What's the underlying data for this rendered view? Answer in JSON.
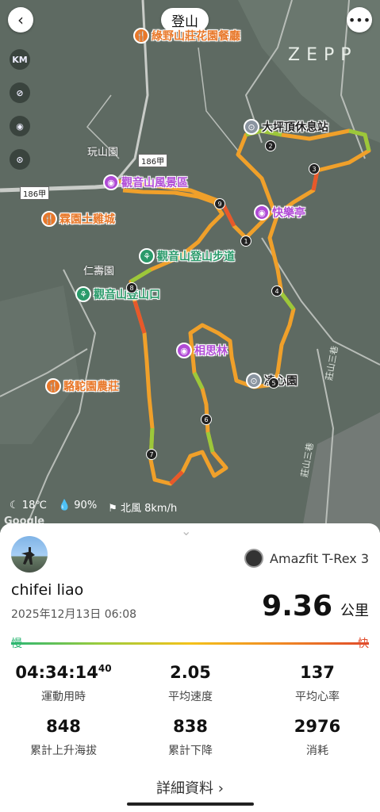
{
  "header": {
    "title": "登山",
    "back_icon": "chevron-left-icon",
    "more_icon": "more-horiz-icon",
    "brand": "ZEPP"
  },
  "toolbar": {
    "km_label": "KM"
  },
  "map": {
    "pois": [
      {
        "label": "綠野山莊花園餐廳",
        "color": "#e8782a",
        "glyph": "🍴"
      },
      {
        "label": "大坪頂休息站",
        "color": "#8a94a0",
        "glyph": "⊙"
      },
      {
        "label": "觀音山風景區",
        "color": "#b04ad6",
        "glyph": "◉"
      },
      {
        "label": "快樂亭",
        "color": "#b04ad6",
        "glyph": "◉"
      },
      {
        "label": "霖園土雞城",
        "color": "#e8782a",
        "glyph": "🍴"
      },
      {
        "label": "觀音山登山步道",
        "color": "#2a9a6a",
        "glyph": "⚘"
      },
      {
        "label": "觀音山登山口",
        "color": "#2a9a6a",
        "glyph": "⚘"
      },
      {
        "label": "相思林",
        "color": "#b04ad6",
        "glyph": "◉"
      },
      {
        "label": "凌心園",
        "color": "#8a94a0",
        "glyph": "⊙"
      },
      {
        "label": "駱駝園農莊",
        "color": "#e8782a",
        "glyph": "🍴"
      }
    ],
    "places": [
      "玩山園",
      "仁壽園"
    ],
    "road_badges": [
      "186甲",
      "186甲"
    ],
    "streets": [
      "莊山三巷",
      "莊山三巷"
    ],
    "waypoints": [
      "1",
      "2",
      "3",
      "4",
      "5",
      "6",
      "7",
      "8",
      "9"
    ],
    "weather": {
      "temp": "18℃",
      "humidity": "90%",
      "wind": "北風 8km/h"
    },
    "attribution": "Google"
  },
  "summary": {
    "device": "Amazfit T-Rex 3",
    "user": "chifei liao",
    "date": "2025年12月13日 06:08",
    "distance": "9.36",
    "distance_unit": "公里",
    "pace_slow": "慢",
    "pace_fast": "快",
    "stats": [
      {
        "value": "04:34:14",
        "sup": "40",
        "label": "運動用時"
      },
      {
        "value": "2.05",
        "sup": "",
        "label": "平均速度"
      },
      {
        "value": "137",
        "sup": "",
        "label": "平均心率"
      },
      {
        "value": "848",
        "sup": "",
        "label": "累計上升海拔"
      },
      {
        "value": "838",
        "sup": "",
        "label": "累計下降"
      },
      {
        "value": "2976",
        "sup": "",
        "label": "消耗"
      }
    ],
    "details_link": "詳細資料 ›"
  }
}
